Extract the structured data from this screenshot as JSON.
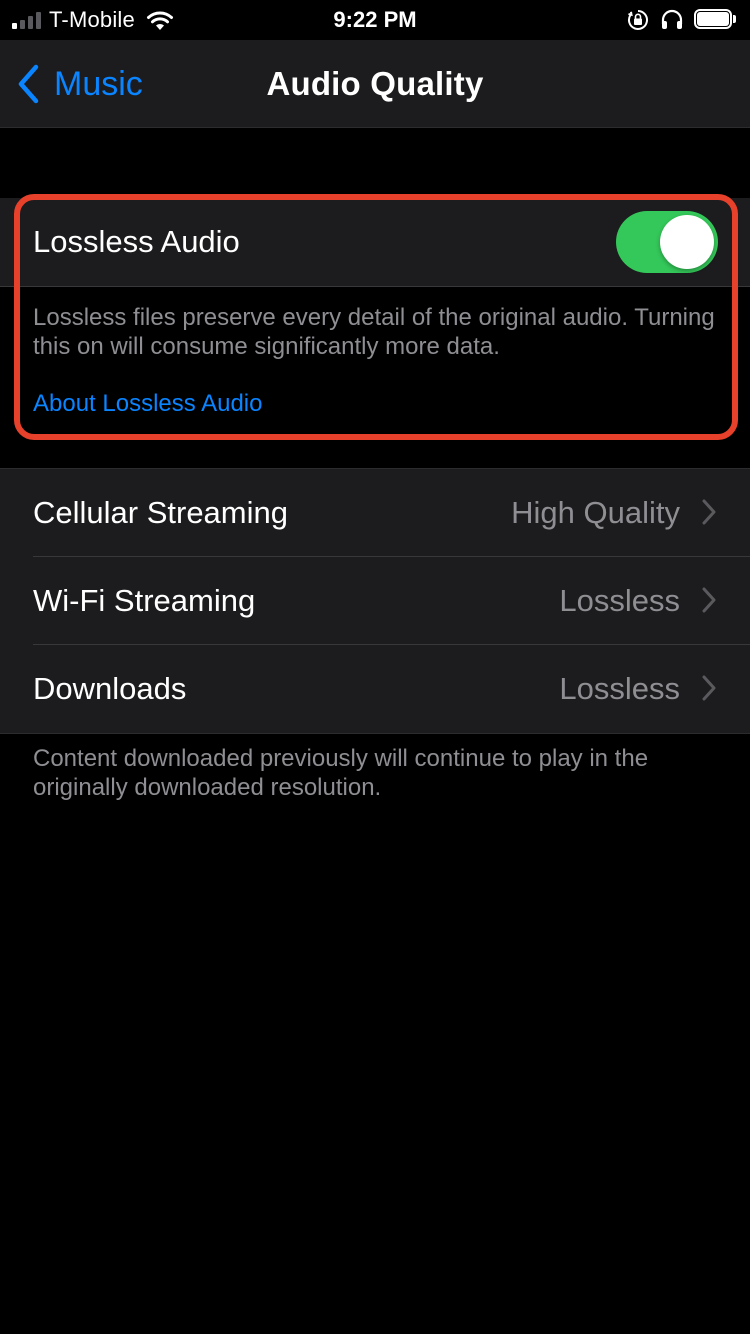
{
  "status_bar": {
    "carrier": "T-Mobile",
    "time": "9:22 PM",
    "signal_bars_active": 1,
    "battery_level_percent": 100,
    "icons": [
      "wifi-icon",
      "orientation-lock-icon",
      "headphones-icon",
      "battery-icon"
    ]
  },
  "nav": {
    "back_label": "Music",
    "title": "Audio Quality"
  },
  "lossless": {
    "label": "Lossless Audio",
    "enabled": true,
    "description": "Lossless files preserve every detail of the original audio. Turning this on will consume significantly more data.",
    "link": "About Lossless Audio"
  },
  "streaming": {
    "rows": [
      {
        "label": "Cellular Streaming",
        "value": "High Quality"
      },
      {
        "label": "Wi-Fi Streaming",
        "value": "Lossless"
      },
      {
        "label": "Downloads",
        "value": "Lossless"
      }
    ],
    "footer": "Content downloaded previously will continue to play in the originally downloaded resolution."
  },
  "colors": {
    "background": "#000000",
    "cell": "#1c1c1e",
    "accent_blue": "#0a84ff",
    "toggle_on": "#34c759",
    "highlight": "#e8412b",
    "secondary_text": "#8e8e93"
  }
}
